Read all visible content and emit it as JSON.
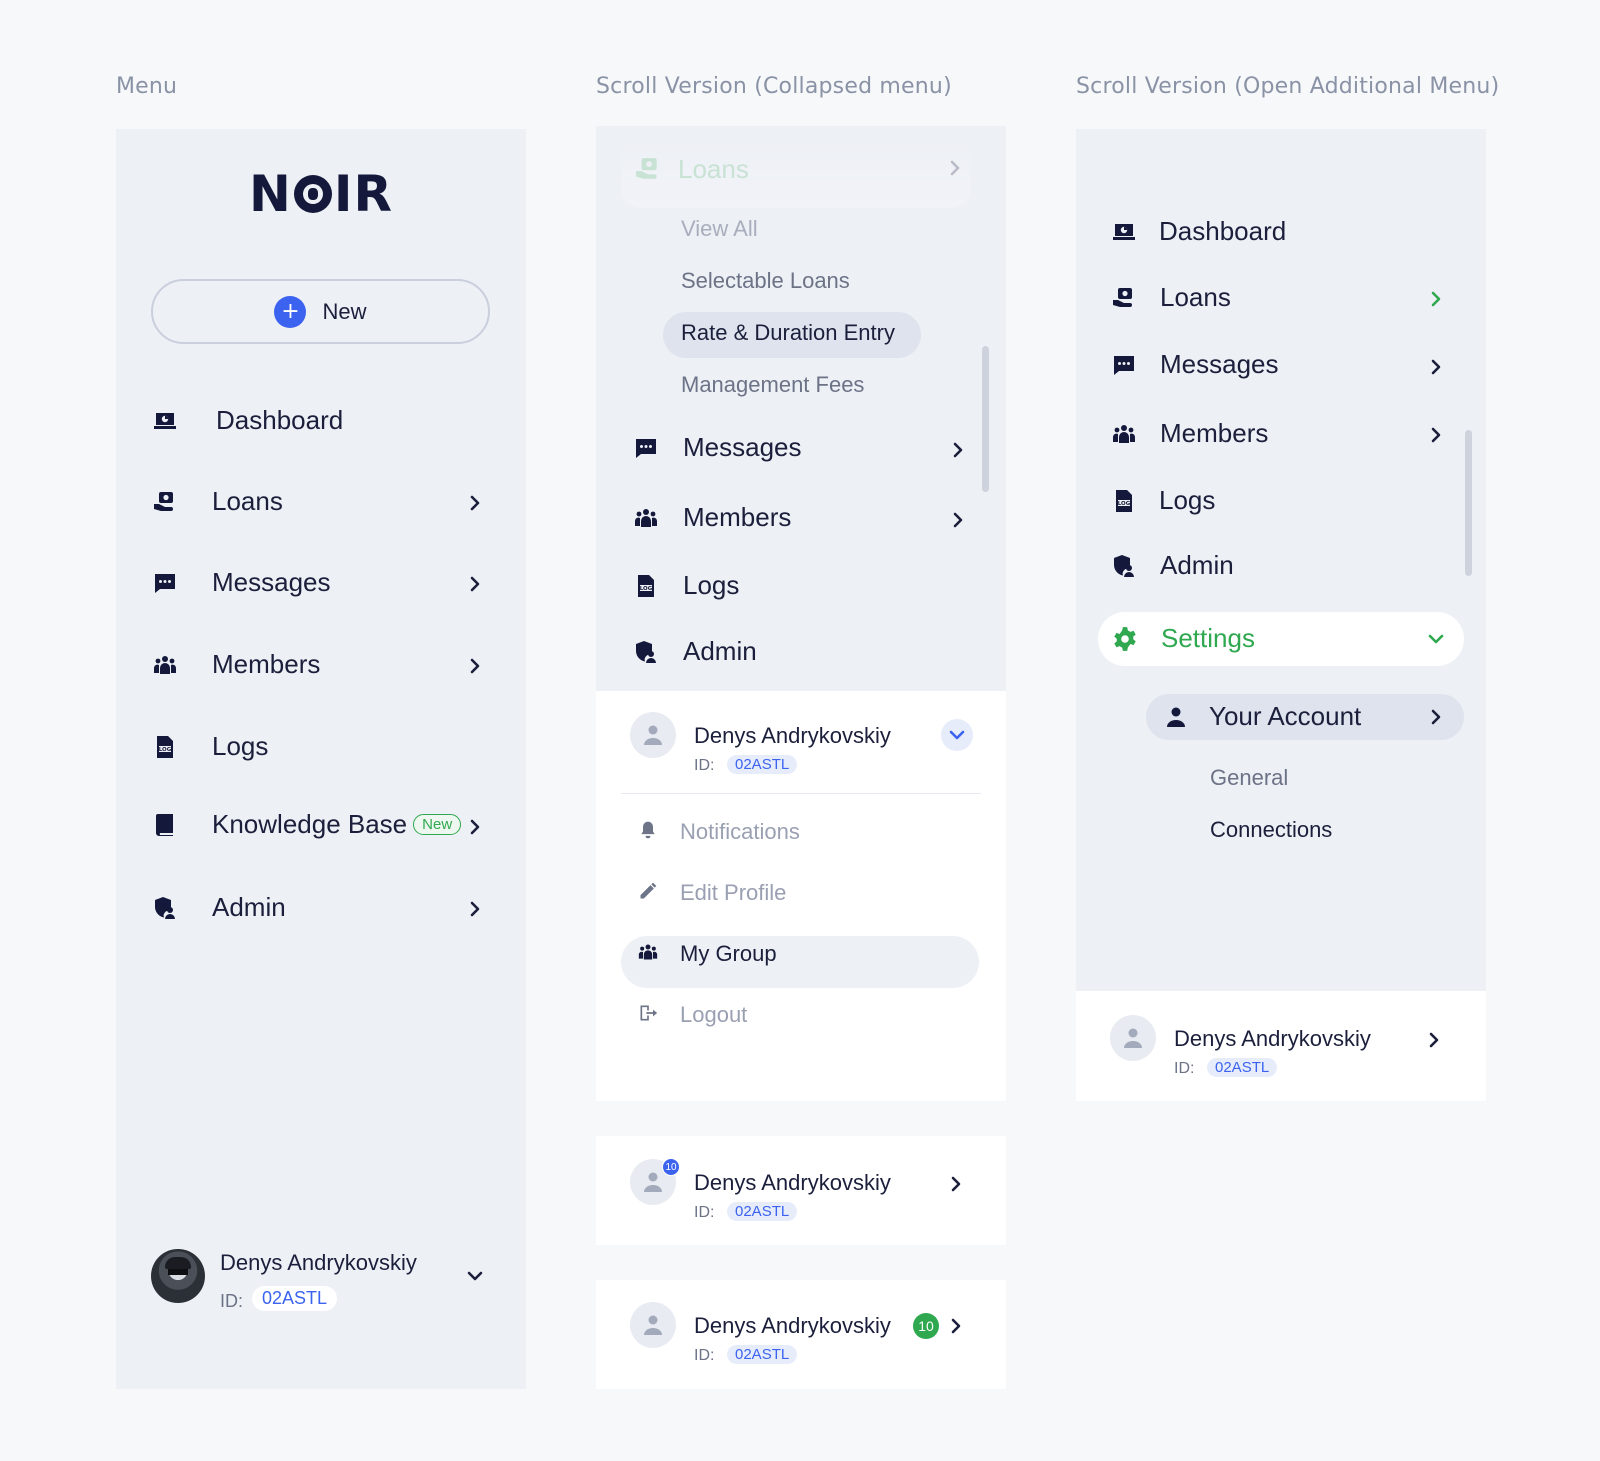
{
  "columns": {
    "menu_title": "Menu",
    "collapsed_title": "Scroll Version (Collapsed menu)",
    "open_title": "Scroll Version (Open Additional Menu)"
  },
  "menu": {
    "logo": "N IR",
    "new_button": "New",
    "items": [
      {
        "label": "Dashboard",
        "icon": "dashboard-icon"
      },
      {
        "label": "Loans",
        "icon": "loans-icon"
      },
      {
        "label": "Messages",
        "icon": "messages-icon"
      },
      {
        "label": "Members",
        "icon": "members-icon"
      },
      {
        "label": "Logs",
        "icon": "logs-icon"
      },
      {
        "label": "Knowledge Base",
        "icon": "book-icon",
        "badge": "New"
      },
      {
        "label": "Admin",
        "icon": "admin-icon"
      }
    ],
    "user": {
      "name": "Denys Andrykovskiy",
      "id_label": "ID:",
      "id": "02ASTL"
    }
  },
  "collapsed": {
    "loans_label": "Loans",
    "loans_sub": [
      "View All",
      "Selectable Loans",
      "Rate & Duration Entry",
      "Management Fees"
    ],
    "items": [
      {
        "label": "Messages"
      },
      {
        "label": "Members"
      },
      {
        "label": "Logs"
      },
      {
        "label": "Admin"
      }
    ],
    "user": {
      "name": "Denys Andrykovskiy",
      "id_label": "ID:",
      "id": "02ASTL"
    },
    "user_menu": [
      "Notifications",
      "Edit Profile",
      "My Group",
      "Logout"
    ],
    "card2": {
      "name": "Denys Andrykovskiy",
      "id_label": "ID:",
      "id": "02ASTL",
      "badge": "10"
    },
    "card3": {
      "name": "Denys Andrykovskiy",
      "id_label": "ID:",
      "id": "02ASTL",
      "badge": "10"
    }
  },
  "open": {
    "items": [
      {
        "label": "Dashboard"
      },
      {
        "label": "Loans"
      },
      {
        "label": "Messages"
      },
      {
        "label": "Members"
      },
      {
        "label": "Logs"
      },
      {
        "label": "Admin"
      }
    ],
    "settings_label": "Settings",
    "your_account": "Your Account",
    "account_sub": [
      "General",
      "Connections"
    ],
    "user": {
      "name": "Denys Andrykovskiy",
      "id_label": "ID:",
      "id": "02ASTL"
    }
  },
  "colors": {
    "accent_blue": "#3b63f0",
    "accent_green": "#2fa84f",
    "panel_bg": "#edf0f5",
    "text_dark": "#1b1f3b"
  }
}
